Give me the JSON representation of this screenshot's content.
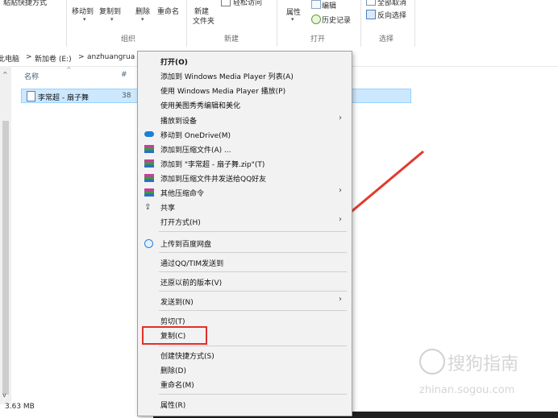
{
  "ribbon": {
    "paste_shortcut": "粘贴快捷方式",
    "move_to": "移动到",
    "copy_to": "复制到",
    "delete": "删除",
    "rename": "重命名",
    "new_folder_line1": "新建",
    "new_folder_line2": "文件夹",
    "easy_access": "轻松访问",
    "properties": "属性",
    "edit": "编辑",
    "history": "历史记录",
    "select_all": "全部取消",
    "invert_selection": "反向选择",
    "group_organize": "组织",
    "group_new": "新建",
    "group_open": "打开",
    "group_select": "选择"
  },
  "address": {
    "pc": "此电脑",
    "sep": ">",
    "drive": "新加卷 (E:)",
    "folder": "anzhuangrua"
  },
  "file_list": {
    "col_name": "名称",
    "col_num": "#",
    "file_name": "李常超 - 扇子舞",
    "file_num": "38"
  },
  "status": {
    "size": "3.63 MB"
  },
  "context_menu": {
    "open": "打开(O)",
    "add_wmp": "添加到 Windows Media Player 列表(A)",
    "play_wmp": "使用 Windows Media Player 播放(P)",
    "meitu": "使用美图秀秀编辑和美化",
    "cast": "播放到设备",
    "onedrive": "移动到 OneDrive(M)",
    "add_archive": "添加到压缩文件(A) ...",
    "add_zip": "添加到 \"李常超 - 扇子舞.zip\"(T)",
    "zip_qq": "添加到压缩文件并发送给QQ好友",
    "other_zip": "其他压缩命令",
    "share": "共享",
    "open_with": "打开方式(H)",
    "baidu": "上传到百度网盘",
    "qq_send": "通过QQ/TIM发送到",
    "restore": "还原以前的版本(V)",
    "send_to": "发送到(N)",
    "cut": "剪切(T)",
    "copy": "复制(C)",
    "shortcut": "创建快捷方式(S)",
    "delete": "删除(D)",
    "rename": "重命名(M)",
    "properties": "属性(R)",
    "submenu_arrow": "›"
  },
  "watermark": {
    "brand": "搜狗指南",
    "url": "zhinan.sogou.com"
  },
  "colors": {
    "selection": "#cce8ff",
    "menu_bg": "#f2f2f2",
    "annotation_red": "#e0302a"
  }
}
